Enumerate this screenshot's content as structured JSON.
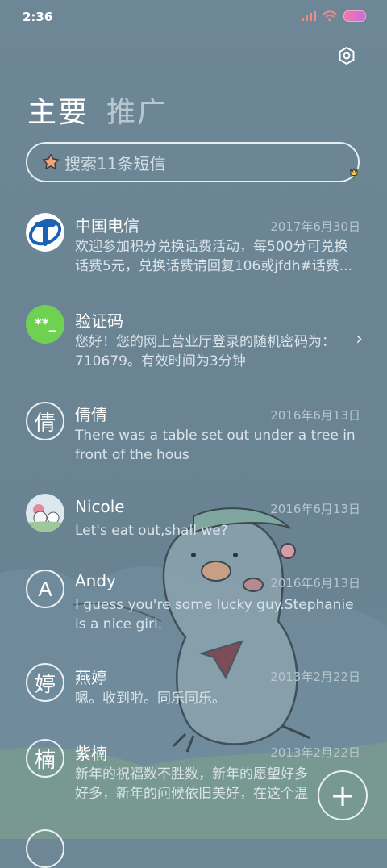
{
  "status_bar": {
    "time": "2:36"
  },
  "tabs": [
    {
      "label": "主要",
      "active": true
    },
    {
      "label": "推广",
      "active": false
    }
  ],
  "search": {
    "placeholder": "搜索11条短信"
  },
  "conversations": [
    {
      "name": "中国电信",
      "date": "2017年6月30日",
      "preview": "欢迎参加积分兑换话费活动，每500分可兑换话费5元，兑换话费请回复106或jfdh#话费..."
    },
    {
      "name": "验证码",
      "date": "",
      "preview": "您好！您的网上营业厅登录的随机密码为：710679。有效时间为3分钟",
      "avatar_text": "**_"
    },
    {
      "name": "倩倩",
      "date": "2016年6月13日",
      "preview": "There was a table set out under a tree in front of the hous",
      "avatar_text": "倩"
    },
    {
      "name": "Nicole",
      "date": "2016年6月13日",
      "preview": "Let's eat out,shall we?"
    },
    {
      "name": "Andy",
      "date": "2016年6月13日",
      "preview": "I guess you're some lucky guy.Stephanie is a nice girl.",
      "avatar_text": "A"
    },
    {
      "name": "燕婷",
      "date": "2013年2月22日",
      "preview": "嗯。收到啦。同乐同乐。",
      "avatar_text": "婷"
    },
    {
      "name": "紫楠",
      "date": "2013年2月22日",
      "preview": "新年的祝福数不胜数，新年的愿望好多好多，新年的问候依旧美好，在这个温馨的时刻",
      "avatar_text": "楠"
    }
  ],
  "colors": {
    "verify_avatar": "#6fd152",
    "telecom_blue": "#1b62b3"
  }
}
